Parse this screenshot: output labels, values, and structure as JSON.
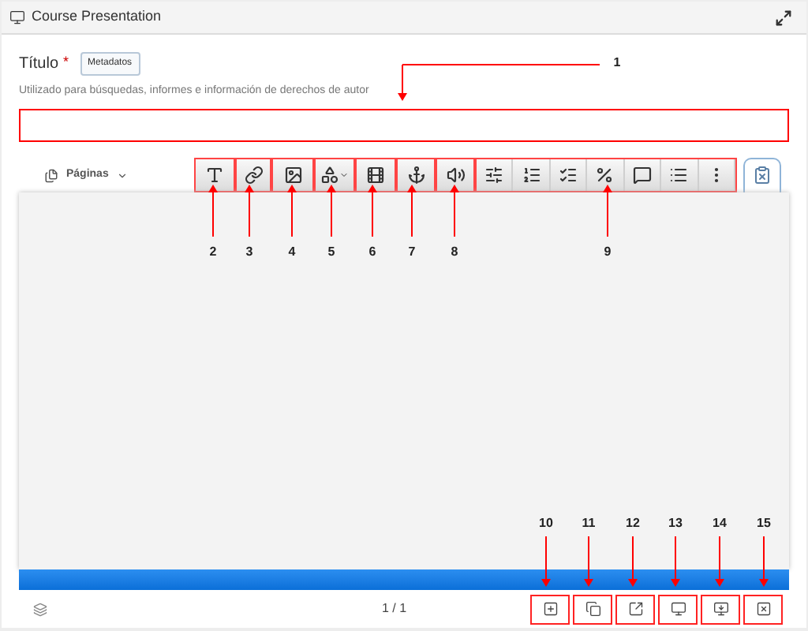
{
  "window": {
    "title": "Course Presentation"
  },
  "title_field": {
    "label": "Título",
    "required_mark": "*",
    "tag": "Metadatos",
    "hint": "Utilizado para búsquedas, informes e información de derechos de autor"
  },
  "pages_menu": {
    "label": "Páginas"
  },
  "pagination": "1 / 1",
  "callouts": [
    {
      "label": "1"
    },
    {
      "label": "2"
    },
    {
      "label": "3"
    },
    {
      "label": "4"
    },
    {
      "label": "5"
    },
    {
      "label": "6"
    },
    {
      "label": "7"
    },
    {
      "label": "8"
    },
    {
      "label": "9"
    },
    {
      "label": "10"
    },
    {
      "label": "11"
    },
    {
      "label": "12"
    },
    {
      "label": "13"
    },
    {
      "label": "14"
    },
    {
      "label": "15"
    }
  ]
}
